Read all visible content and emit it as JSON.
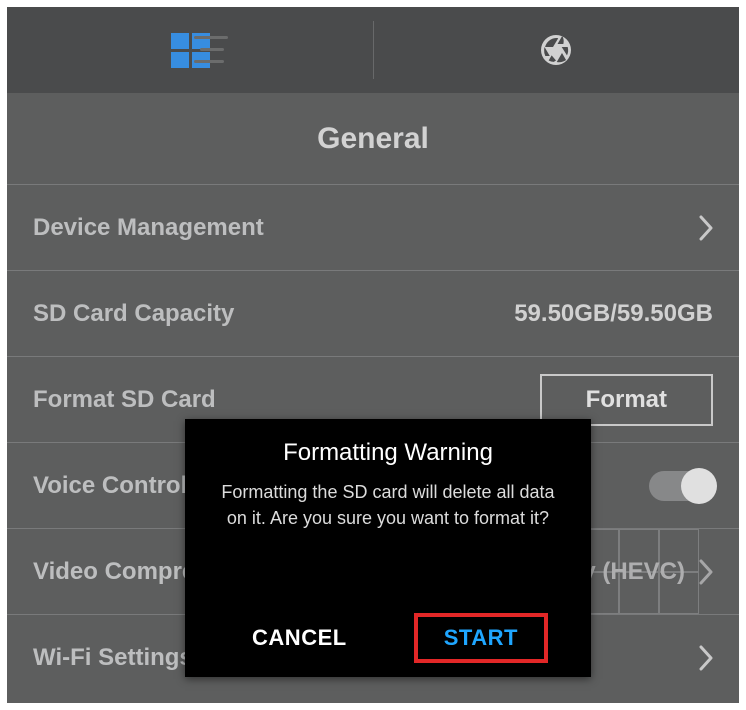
{
  "tabs": {
    "grid": "grid",
    "camera": "camera"
  },
  "section_title": "General",
  "rows": {
    "device_mgmt": {
      "label": "Device Management"
    },
    "sd_capacity": {
      "label": "SD Card Capacity",
      "value": "59.50GB/59.50GB"
    },
    "format_sd": {
      "label": "Format SD Card",
      "button": "Format"
    },
    "voice_ctl": {
      "label": "Voice Control"
    },
    "video_comp": {
      "label": "Video Compress",
      "value_partial": "y (HEVC)"
    },
    "wifi": {
      "label": "Wi-Fi Settings"
    }
  },
  "dialog": {
    "title": "Formatting Warning",
    "body": "Formatting the SD card will delete all data on it. Are you sure  you want to format it?",
    "cancel": "CANCEL",
    "start": "START"
  }
}
